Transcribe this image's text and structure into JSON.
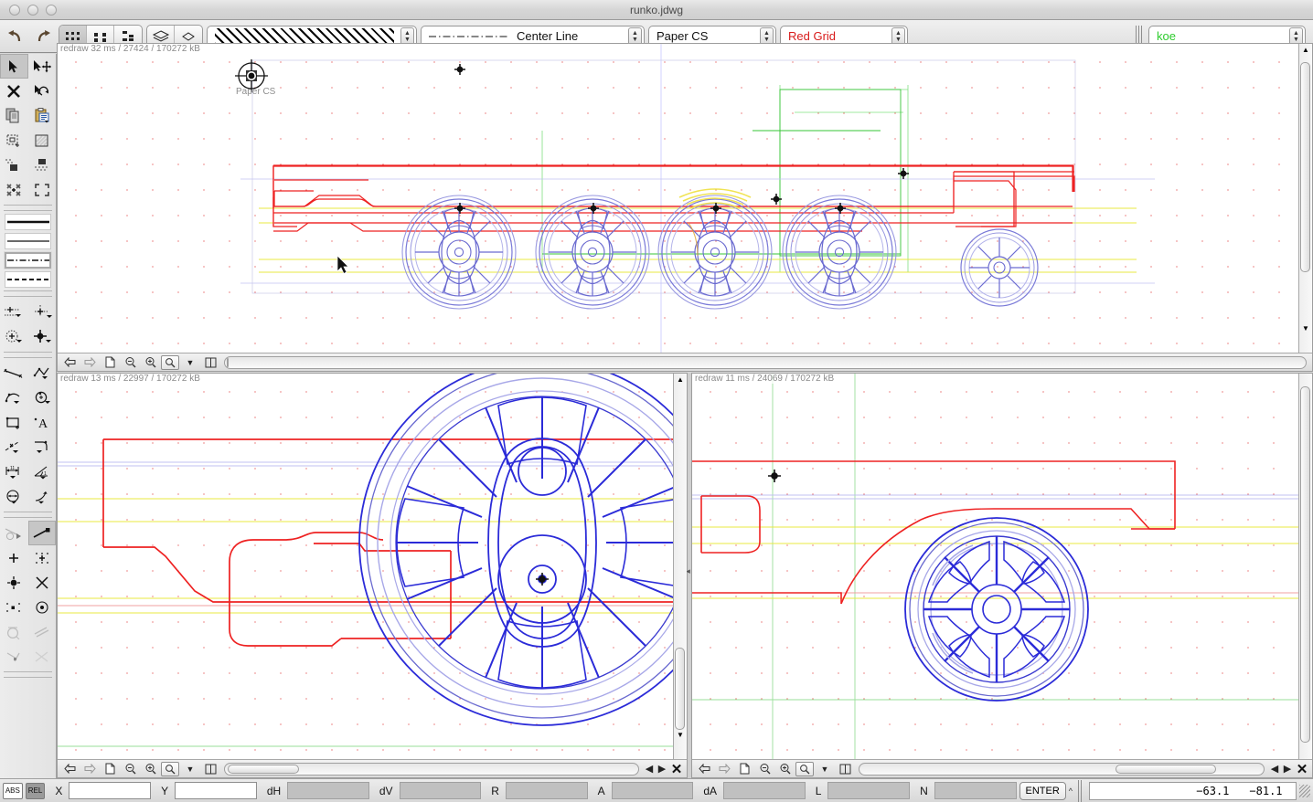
{
  "window": {
    "title": "runko.jdwg",
    "controls": [
      "close",
      "minimize",
      "zoom"
    ]
  },
  "toolbar": {
    "undo_label": "↰",
    "redo_label": "↱",
    "snap_modes": [
      "snap-grid-coarse",
      "snap-grid-medium",
      "snap-grid-fine"
    ],
    "layer_tools": [
      "layers-icon",
      "view-icon"
    ],
    "hatch": {
      "value": "hatch-diagonal-pattern",
      "name": "hatch-pattern-select"
    },
    "linetype": {
      "value": "Center Line",
      "name": "linetype-select"
    },
    "coordsystem": {
      "value": "Paper CS",
      "name": "coordinate-system-select"
    },
    "grid": {
      "value": "Red Grid",
      "color": "#d81b1b",
      "name": "grid-select"
    },
    "layer": {
      "value": "koe",
      "color": "#2ecc2e",
      "name": "layer-select"
    }
  },
  "palette": {
    "edit_tools": [
      {
        "name": "select-arrow-tool",
        "label": "select",
        "selected": true
      },
      {
        "name": "move-tool",
        "label": "move",
        "selected": false
      },
      {
        "name": "delete-tool",
        "label": "delete",
        "selected": false
      },
      {
        "name": "rotate-tool",
        "label": "rotate",
        "selected": false
      },
      {
        "name": "copy-tool",
        "label": "copy",
        "selected": false
      },
      {
        "name": "paste-tool",
        "label": "paste",
        "selected": false
      },
      {
        "name": "select-window-tool",
        "label": "select window",
        "selected": false
      },
      {
        "name": "hatch-fill-tool",
        "label": "hatch",
        "selected": false
      },
      {
        "name": "group-tool",
        "label": "group",
        "selected": false
      },
      {
        "name": "ungroup-tool",
        "label": "ungroup",
        "selected": false
      },
      {
        "name": "collapse-tool",
        "label": "collapse",
        "selected": false
      },
      {
        "name": "expand-tool",
        "label": "expand",
        "selected": false
      }
    ],
    "line_styles": [
      {
        "name": "linestyle-thick-solid",
        "selected": false
      },
      {
        "name": "linestyle-thin-solid",
        "selected": false
      },
      {
        "name": "linestyle-center-dashdot",
        "selected": true
      },
      {
        "name": "linestyle-dashed",
        "selected": false
      }
    ],
    "point_tools": [
      {
        "name": "point-array-tool"
      },
      {
        "name": "axis-point-tool"
      },
      {
        "name": "circle-point-tool"
      },
      {
        "name": "center-mark-tool"
      }
    ],
    "draw_tools": [
      {
        "name": "line-tool"
      },
      {
        "name": "polyline-tool"
      },
      {
        "name": "arc-tool"
      },
      {
        "name": "circle-tool"
      },
      {
        "name": "rectangle-tool"
      },
      {
        "name": "text-tool"
      },
      {
        "name": "construction-line-tool"
      },
      {
        "name": "fillet-tool"
      },
      {
        "name": "linear-dimension-tool"
      },
      {
        "name": "angular-dimension-tool"
      },
      {
        "name": "diameter-dimension-tool"
      },
      {
        "name": "leader-tool"
      }
    ],
    "snap_tools": [
      {
        "name": "snap-tangent-tool",
        "selected": false
      },
      {
        "name": "snap-endpoint-tool",
        "selected": true
      },
      {
        "name": "snap-point-tool",
        "selected": false
      },
      {
        "name": "snap-grid-tool",
        "selected": false
      },
      {
        "name": "snap-node-tool",
        "selected": false
      },
      {
        "name": "snap-intersection-tool",
        "selected": false
      },
      {
        "name": "snap-midpoint-tool",
        "selected": false
      },
      {
        "name": "snap-center-tool",
        "selected": false
      },
      {
        "name": "snap-quadrant-tool",
        "selected": false
      },
      {
        "name": "snap-parallel-tool",
        "selected": false
      },
      {
        "name": "snap-perpendicular-tool",
        "selected": false
      },
      {
        "name": "snap-nearest-tool",
        "selected": false
      }
    ]
  },
  "viewports": {
    "top": {
      "status": "redraw 32 ms / 27424 / 170272 kB",
      "cs_label": "Paper CS",
      "view": "locomotive-chassis-side-elevation"
    },
    "bottom_left": {
      "status": "redraw 13 ms / 22997 / 170272 kB",
      "view": "driving-wheel-detail"
    },
    "bottom_right": {
      "status": "redraw 11 ms / 24069 / 170272 kB",
      "view": "trailing-wheel-detail"
    },
    "toolbar_buttons": [
      {
        "name": "view-back-button",
        "glyph": "⇦"
      },
      {
        "name": "view-forward-button",
        "glyph": "⇨"
      },
      {
        "name": "zoom-fit-page-button",
        "glyph": "page"
      },
      {
        "name": "zoom-out-button",
        "glyph": "zoom-out"
      },
      {
        "name": "zoom-in-button",
        "glyph": "zoom-in"
      },
      {
        "name": "zoom-window-button",
        "glyph": "zoom-window"
      },
      {
        "name": "zoom-menu-button",
        "glyph": "▼"
      },
      {
        "name": "split-view-button",
        "glyph": "split"
      }
    ]
  },
  "statusbar": {
    "mode_abs": "ABS",
    "mode_rel": "REL",
    "fields": [
      {
        "label": "X",
        "name": "x-field",
        "value": "",
        "disabled": false
      },
      {
        "label": "Y",
        "name": "y-field",
        "value": "",
        "disabled": false
      },
      {
        "label": "dH",
        "name": "dh-field",
        "value": "",
        "disabled": true
      },
      {
        "label": "dV",
        "name": "dv-field",
        "value": "",
        "disabled": true
      },
      {
        "label": "R",
        "name": "r-field",
        "value": "",
        "disabled": true
      },
      {
        "label": "A",
        "name": "a-field",
        "value": "",
        "disabled": true
      },
      {
        "label": "dA",
        "name": "da-field",
        "value": "",
        "disabled": true
      },
      {
        "label": "L",
        "name": "l-field",
        "value": "",
        "disabled": true
      },
      {
        "label": "N",
        "name": "n-field",
        "value": "",
        "disabled": true
      }
    ],
    "enter_label": "ENTER",
    "cursor_x": "−63.1",
    "cursor_y": "−81.1"
  },
  "colors": {
    "geometry_blue": "#2b2bd8",
    "geometry_blue_light": "#a8a8e8",
    "geometry_red": "#ee2222",
    "construction_green": "#36c436",
    "construction_yellow": "#e8e840",
    "grid_dot": "#e23b3b",
    "layer_green": "#2ecc2e"
  }
}
